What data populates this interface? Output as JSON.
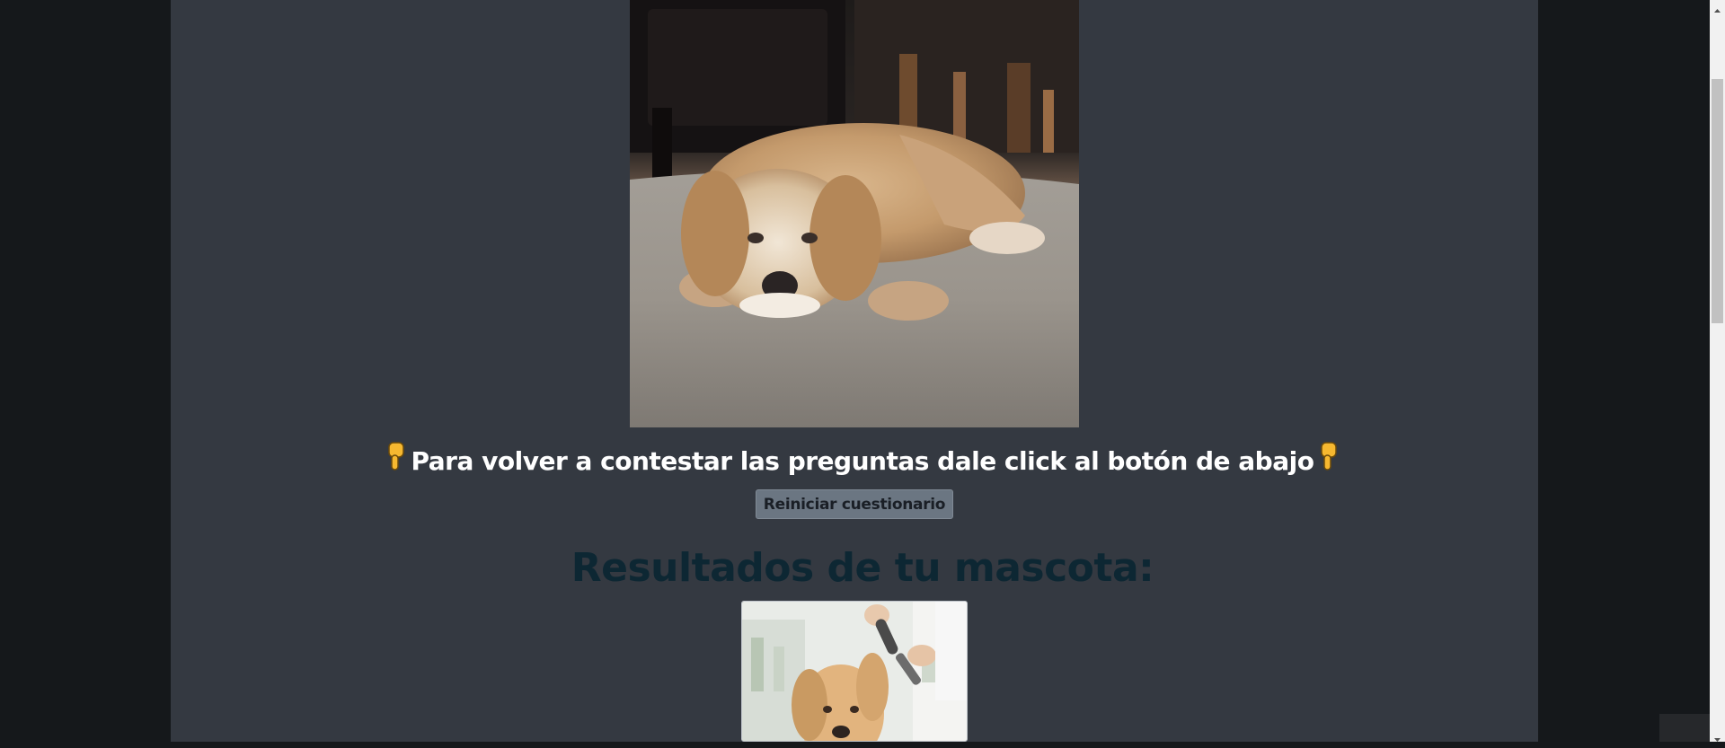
{
  "content": {
    "instruction_text": "Para volver a contestar las preguntas dale click al botón de abajo",
    "reset_button_label": "Reiniciar cuestionario",
    "results_title": "Resultados de tu mascota:"
  },
  "icons": {
    "left": "pointing-down-hand-icon",
    "right": "pointing-down-hand-icon"
  },
  "colors": {
    "page_background": "#15181b",
    "panel_background": "#343941",
    "instruction_text": "#ffffff",
    "button_background": "#6b7682",
    "results_title": "#0d2733"
  }
}
